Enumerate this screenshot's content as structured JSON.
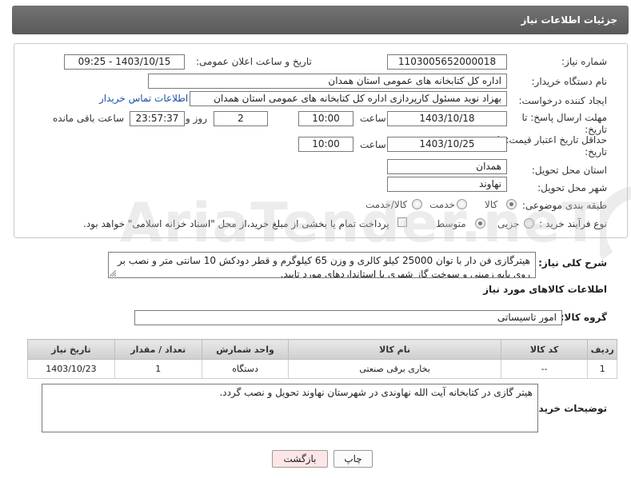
{
  "header": {
    "title": "جزئیات اطلاعات نیاز"
  },
  "form": {
    "need_number_label": "شماره نیاز:",
    "need_number": "1103005652000018",
    "announce_label": "تاریخ و ساعت اعلان عمومی:",
    "announce_value": "1403/10/15 - 09:25",
    "buyer_org_label": "نام دستگاه خریدار:",
    "buyer_org": "اداره کل کتابخانه های عمومی استان همدان",
    "creator_label": "ایجاد کننده درخواست:",
    "creator": "بهزاد نوید مسئول کارپردازی اداره کل کتابخانه های عمومی استان همدان",
    "contact_link": "اطلاعات تماس خریدار",
    "reply_deadline_label_1": "مهلت ارسال پاسخ: تا",
    "reply_deadline_label_2": "تاریخ:",
    "reply_date": "1403/10/18",
    "time_label": "ساعت",
    "reply_time": "10:00",
    "days_value": "2",
    "days_label": "روز و",
    "remaining_value": "23:57:37",
    "remaining_label": "ساعت باقی مانده",
    "price_valid_label_1": "حداقل تاریخ اعتبار قیمت: تا",
    "price_valid_label_2": "تاریخ:",
    "price_valid_date": "1403/10/25",
    "price_valid_time": "10:00",
    "province_label": "استان محل تحویل:",
    "province": "همدان",
    "city_label": "شهر محل تحویل:",
    "city": "نهاوند",
    "category_label": "طبقه بندی موضوعی:",
    "category_options": [
      "کالا",
      "خدمت",
      "کالا/خدمت"
    ],
    "process_label": "نوع فرآیند خرید :",
    "process_options": [
      "جزیی",
      "متوسط"
    ],
    "payment_note": "پرداخت تمام یا بخشی از مبلغ خرید،از محل \"اسناد خزانه اسلامی\" خواهد بود."
  },
  "need_desc": {
    "label": "شرح کلی نیاز:",
    "text": "هیترگازی فن دار با توان 25000 کیلو کالری و وزن 65 کیلوگرم و قطر دودکش 10 سانتی متر و نصب بر روی پایه زمینی و سوخت گاز شهری با استانداردهای مورد تایید."
  },
  "goods": {
    "section_title": "اطلاعات کالاهای مورد نیاز",
    "group_label": "گروه کالا:",
    "group_value": "امور تاسیساتی",
    "columns": [
      "ردیف",
      "کد کالا",
      "نام کالا",
      "واحد شمارش",
      "تعداد / مقدار",
      "تاریخ نیاز"
    ],
    "rows": [
      [
        "1",
        "--",
        "بخاری برقی صنعتی",
        "دستگاه",
        "1",
        "1403/10/23"
      ]
    ]
  },
  "buyer_notes": {
    "label": "توضیحات خریدار:",
    "text": "هیتر گازی در کتابخانه آیت الله نهاوندی در شهرستان نهاوند تحویل و نصب گردد."
  },
  "buttons": {
    "print": "چاپ",
    "back": "بازگشت"
  },
  "watermark": {
    "text": "AriaTender.neT"
  }
}
